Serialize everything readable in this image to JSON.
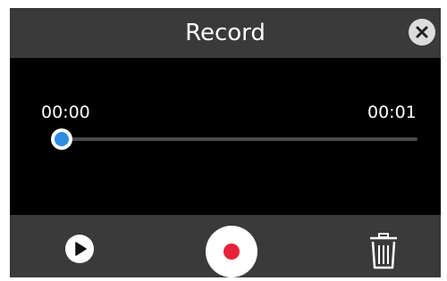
{
  "dialog": {
    "title": "Record",
    "close_icon": "close-icon"
  },
  "player": {
    "current_time": "00:00",
    "total_time": "00:01",
    "progress": 0
  },
  "controls": {
    "play_icon": "play-icon",
    "record_icon": "record-icon",
    "delete_icon": "trash-icon"
  },
  "colors": {
    "header_bg": "#3a3a3a",
    "body_bg": "#000000",
    "accent": "#2d8ee0",
    "record_red": "#e8213a"
  }
}
